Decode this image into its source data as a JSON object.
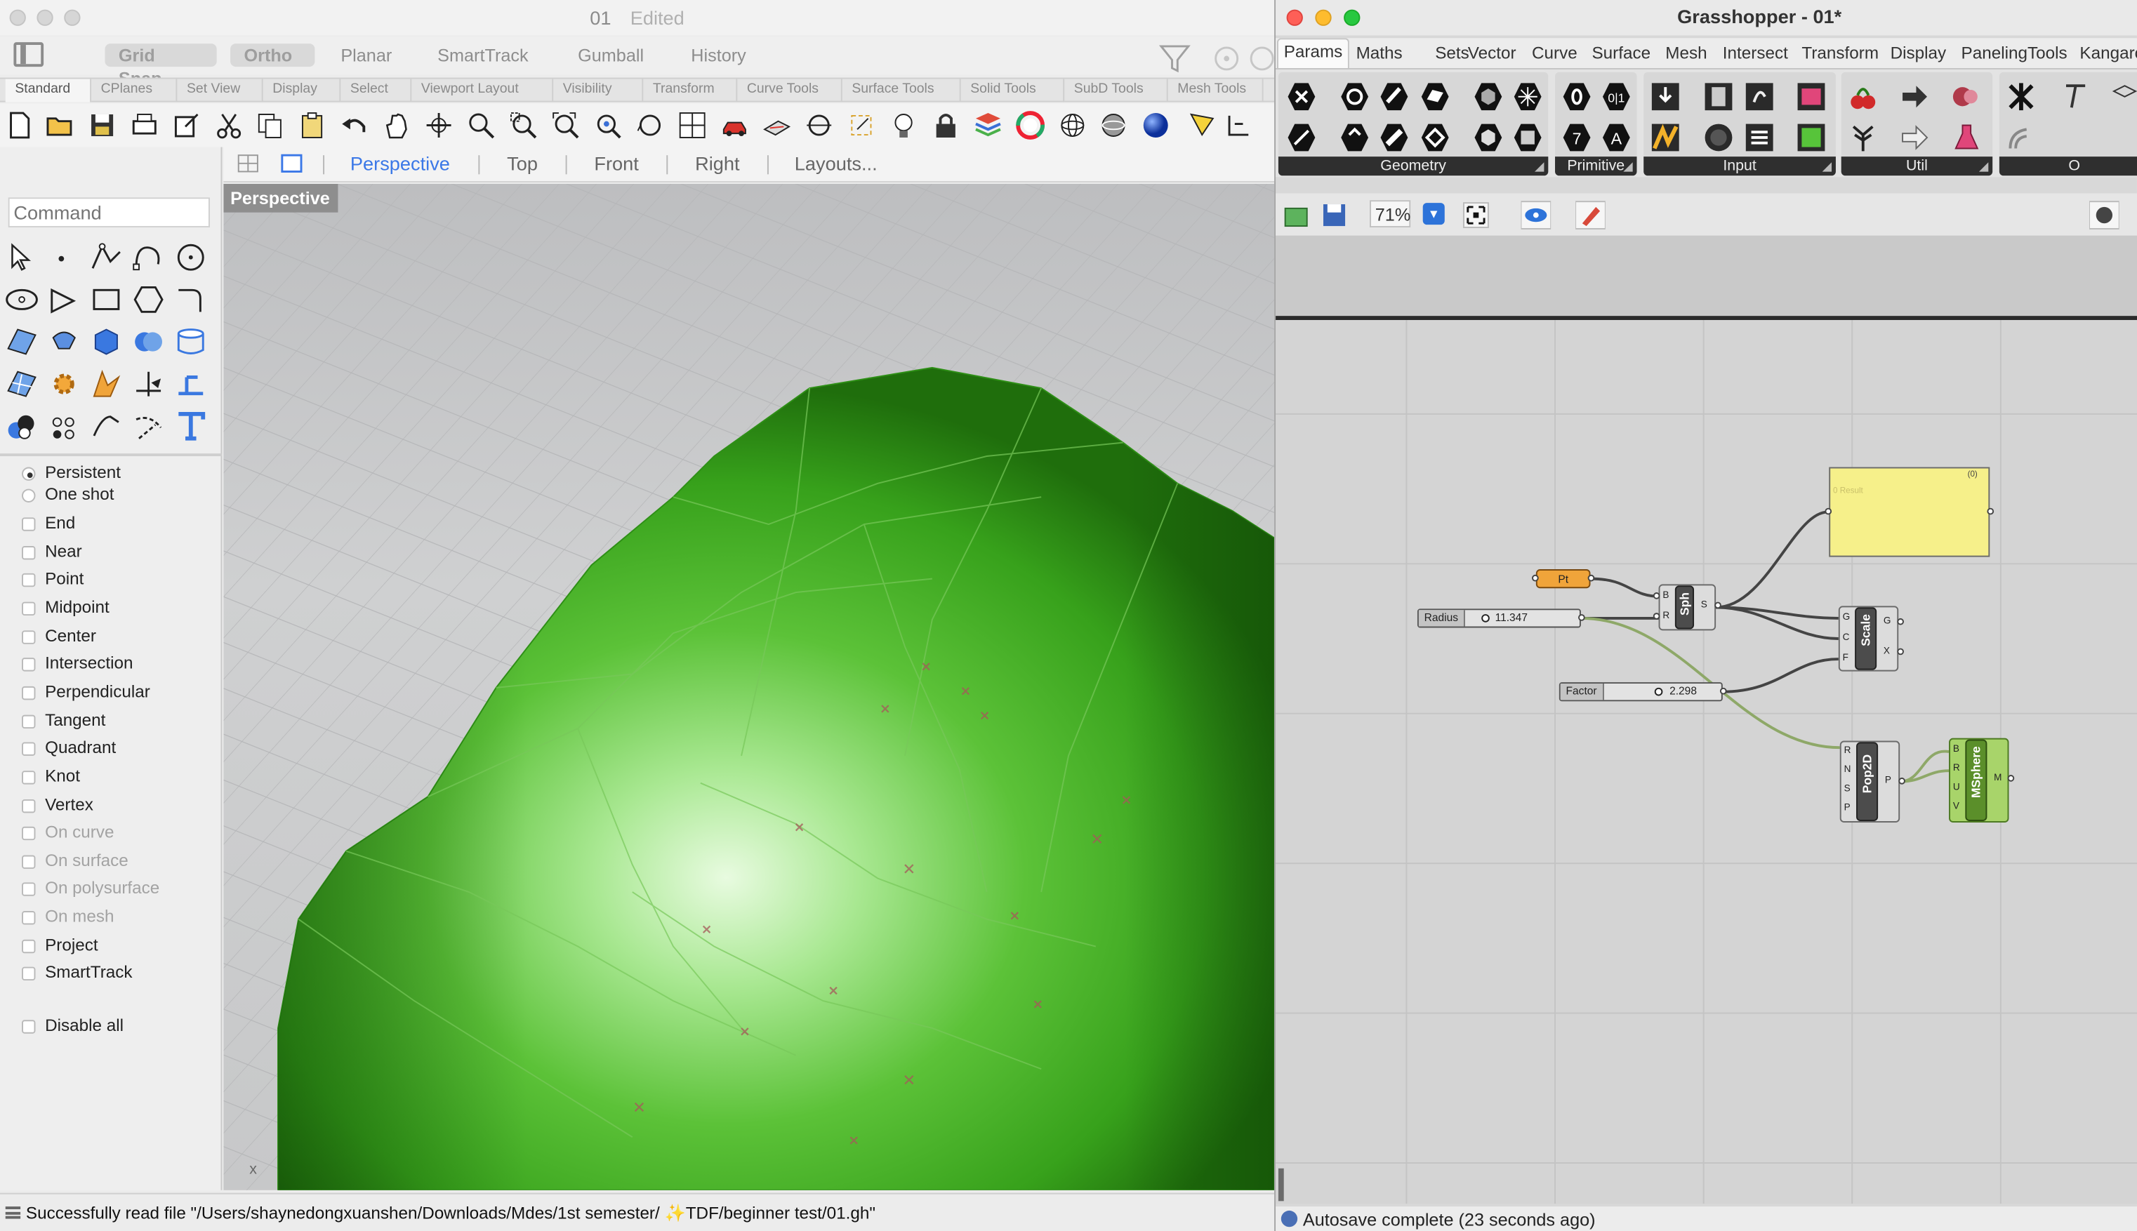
{
  "rhino": {
    "title": "01",
    "title_status": "Edited",
    "modes": [
      "Grid Snap",
      "Ortho",
      "Planar",
      "SmartTrack",
      "Gumball",
      "History"
    ],
    "toolbar_tabs": [
      "Standard",
      "CPlanes",
      "Set View",
      "Display",
      "Select",
      "Viewport Layout",
      "Visibility",
      "Transform",
      "Curve Tools",
      "Surface Tools",
      "Solid Tools",
      "SubD Tools",
      "Mesh Tools"
    ],
    "viewport_tabs": [
      "Perspective",
      "Top",
      "Front",
      "Right",
      "Layouts..."
    ],
    "command_placeholder": "Command",
    "viewport_label": "Perspective",
    "axis_label": "x",
    "snaps": [
      {
        "label": "Persistent",
        "type": "radio",
        "checked": true,
        "enabled": true
      },
      {
        "label": "One shot",
        "type": "radio",
        "checked": false,
        "enabled": true
      },
      {
        "label": "End",
        "type": "check",
        "checked": false,
        "enabled": true
      },
      {
        "label": "Near",
        "type": "check",
        "checked": false,
        "enabled": true
      },
      {
        "label": "Point",
        "type": "check",
        "checked": false,
        "enabled": true
      },
      {
        "label": "Midpoint",
        "type": "check",
        "checked": false,
        "enabled": true
      },
      {
        "label": "Center",
        "type": "check",
        "checked": false,
        "enabled": true
      },
      {
        "label": "Intersection",
        "type": "check",
        "checked": false,
        "enabled": true
      },
      {
        "label": "Perpendicular",
        "type": "check",
        "checked": false,
        "enabled": true
      },
      {
        "label": "Tangent",
        "type": "check",
        "checked": false,
        "enabled": true
      },
      {
        "label": "Quadrant",
        "type": "check",
        "checked": false,
        "enabled": true
      },
      {
        "label": "Knot",
        "type": "check",
        "checked": false,
        "enabled": true
      },
      {
        "label": "Vertex",
        "type": "check",
        "checked": false,
        "enabled": true
      },
      {
        "label": "On curve",
        "type": "check",
        "checked": false,
        "enabled": false
      },
      {
        "label": "On surface",
        "type": "check",
        "checked": false,
        "enabled": false
      },
      {
        "label": "On polysurface",
        "type": "check",
        "checked": false,
        "enabled": false
      },
      {
        "label": "On mesh",
        "type": "check",
        "checked": false,
        "enabled": false
      },
      {
        "label": "Project",
        "type": "check",
        "checked": false,
        "enabled": true
      },
      {
        "label": "SmartTrack",
        "type": "check",
        "checked": false,
        "enabled": true
      },
      {
        "label": "Disable all",
        "type": "check",
        "checked": false,
        "enabled": true
      }
    ],
    "status_text": "Successfully read file \"/Users/shaynedongxuanshen/Downloads/Mdes/1st semester/ ✨TDF/beginner test/01.gh\""
  },
  "grasshopper": {
    "title": "Grasshopper - 01*",
    "menu": [
      "Params",
      "Maths",
      "Sets",
      "Vector",
      "Curve",
      "Surface",
      "Mesh",
      "Intersect",
      "Transform",
      "Display",
      "PanelingTools",
      "Kangaro"
    ],
    "ribbon_groups": [
      "Geometry",
      "Primitive",
      "Input",
      "Util",
      "O"
    ],
    "zoom": "71%",
    "status": "Autosave complete (23 seconds ago)",
    "components": {
      "pt": "Pt",
      "sph": "Sph",
      "scale": "Scale",
      "pop2d": "Pop2D",
      "msphere": "MSphere",
      "panel_index": "(0)",
      "panel_text": "0 Result"
    },
    "sliders": {
      "radius": {
        "label": "Radius",
        "value": "11.347",
        "fraction": 0.08
      },
      "factor": {
        "label": "Factor",
        "value": "2.298",
        "fraction": 0.43
      }
    },
    "ports": {
      "sph_in": [
        "B",
        "R"
      ],
      "sph_out": [
        "S"
      ],
      "scale_in": [
        "G",
        "C",
        "F"
      ],
      "scale_out": [
        "G",
        "X"
      ],
      "pop_in": [
        "R",
        "N",
        "S",
        "P"
      ],
      "pop_out": [
        "P"
      ],
      "msph_in": [
        "B",
        "R",
        "U",
        "V"
      ],
      "msph_out": [
        "M"
      ]
    }
  },
  "colors": {
    "mesh_green": "#3cae1e",
    "mesh_light": "#c9f2b5",
    "gh_pt": "#f0a43a",
    "gh_panel": "#f6f08a",
    "gh_msphere": "#a8d46a",
    "active_tab": "#3b78e7"
  }
}
